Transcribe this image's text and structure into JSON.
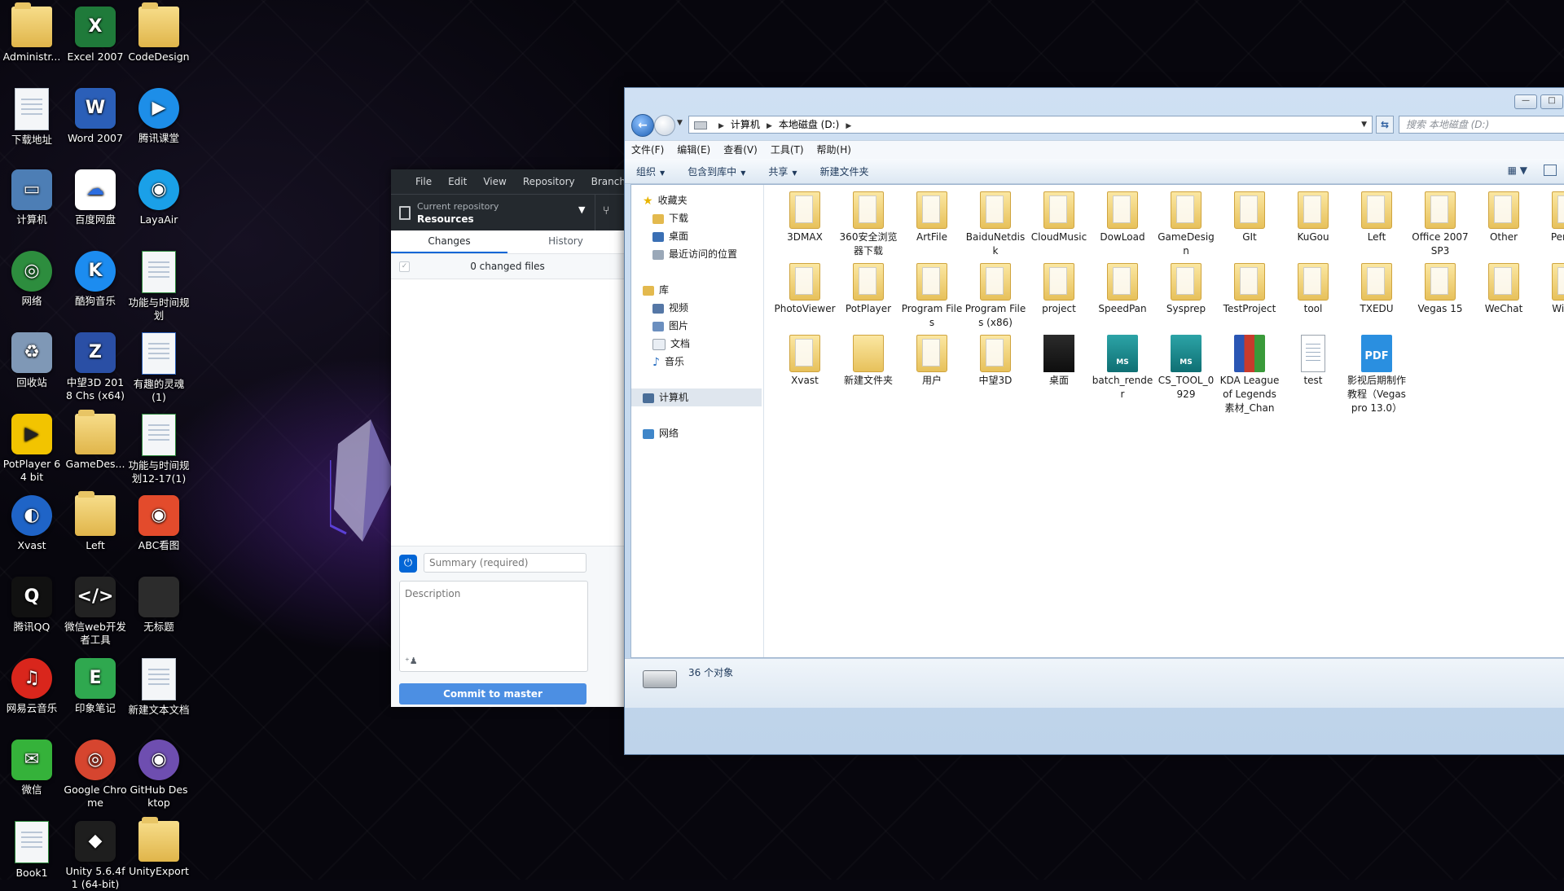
{
  "desktop": {
    "icons": [
      {
        "label": "Administr...",
        "icon": "user-folder-icon"
      },
      {
        "label": "Excel 2007",
        "icon": "excel-icon"
      },
      {
        "label": "CodeDesign",
        "icon": "folder-icon"
      },
      {
        "label": "下载地址",
        "icon": "text-file-icon"
      },
      {
        "label": "Word 2007",
        "icon": "word-icon"
      },
      {
        "label": "腾讯课堂",
        "icon": "tencent-classroom-icon"
      },
      {
        "label": "计算机",
        "icon": "computer-icon"
      },
      {
        "label": "百度网盘",
        "icon": "baidu-netdisk-icon"
      },
      {
        "label": "LayaAir",
        "icon": "layaair-icon"
      },
      {
        "label": "网络",
        "icon": "network-icon"
      },
      {
        "label": "酷狗音乐",
        "icon": "kugou-icon"
      },
      {
        "label": "功能与时间规划",
        "icon": "excel-file-icon"
      },
      {
        "label": "回收站",
        "icon": "recycle-bin-icon"
      },
      {
        "label": "中望3D 2018 Chs (x64)",
        "icon": "zw3d-icon"
      },
      {
        "label": "有趣的灵魂 (1)",
        "icon": "word-file-icon"
      },
      {
        "label": "PotPlayer 64 bit",
        "icon": "potplayer-icon"
      },
      {
        "label": "GameDes...",
        "icon": "folder-icon"
      },
      {
        "label": "功能与时间规划12-17(1)",
        "icon": "excel-file-icon"
      },
      {
        "label": "Xvast",
        "icon": "xvast-icon"
      },
      {
        "label": "Left",
        "icon": "folder-icon"
      },
      {
        "label": "ABC看图",
        "icon": "abc-viewer-icon"
      },
      {
        "label": "腾讯QQ",
        "icon": "qq-icon"
      },
      {
        "label": "微信web开发者工具",
        "icon": "wechat-devtools-icon"
      },
      {
        "label": "无标题",
        "icon": "untitled-icon"
      },
      {
        "label": "网易云音乐",
        "icon": "netease-music-icon"
      },
      {
        "label": "印象笔记",
        "icon": "evernote-icon"
      },
      {
        "label": "新建文本文档",
        "icon": "text-file-icon"
      },
      {
        "label": "微信",
        "icon": "wechat-icon"
      },
      {
        "label": "Google Chrome",
        "icon": "chrome-icon"
      },
      {
        "label": "GitHub Desktop",
        "icon": "github-icon"
      },
      {
        "label": "Book1",
        "icon": "excel-file-icon"
      },
      {
        "label": "Unity 5.6.4f1 (64-bit)",
        "icon": "unity-icon"
      },
      {
        "label": "UnityExport",
        "icon": "folder-icon"
      }
    ]
  },
  "github": {
    "menu": [
      "File",
      "Edit",
      "View",
      "Repository",
      "Branch"
    ],
    "repo_caption": "Current repository",
    "repo_name": "Resources",
    "tabs": [
      "Changes",
      "History"
    ],
    "changed_files": "0 changed files",
    "summary_placeholder": "Summary (required)",
    "description_placeholder": "Description",
    "commit_label": "Commit to master"
  },
  "explorer": {
    "window_controls": [
      "—",
      "□"
    ],
    "breadcrumb": [
      "计算机",
      "本地磁盘 (D:)"
    ],
    "search_placeholder": "搜索 本地磁盘 (D:)",
    "menu": [
      "文件(F)",
      "编辑(E)",
      "查看(V)",
      "工具(T)",
      "帮助(H)"
    ],
    "toolbar": [
      "组织",
      "包含到库中",
      "共享",
      "新建文件夹"
    ],
    "nav": {
      "favorites": "收藏夹",
      "fav_items": [
        "下载",
        "桌面",
        "最近访问的位置"
      ],
      "libraries": "库",
      "lib_items": [
        "视频",
        "图片",
        "文档",
        "音乐"
      ],
      "computer": "计算机",
      "network": "网络"
    },
    "files": [
      {
        "name": "3DMAX",
        "type": "folder"
      },
      {
        "name": "360安全浏览器下载",
        "type": "folder"
      },
      {
        "name": "ArtFile",
        "type": "folder"
      },
      {
        "name": "BaiduNetdisk",
        "type": "folder"
      },
      {
        "name": "CloudMusic",
        "type": "folder"
      },
      {
        "name": "DowLoad",
        "type": "folder"
      },
      {
        "name": "GameDesign",
        "type": "folder"
      },
      {
        "name": "GIt",
        "type": "folder"
      },
      {
        "name": "KuGou",
        "type": "folder"
      },
      {
        "name": "Left",
        "type": "folder"
      },
      {
        "name": "Office 2007 SP3",
        "type": "folder"
      },
      {
        "name": "Other",
        "type": "folder"
      },
      {
        "name": "Person",
        "type": "folder"
      },
      {
        "name": "PhotoViewer",
        "type": "folder"
      },
      {
        "name": "PotPlayer",
        "type": "folder"
      },
      {
        "name": "Program Files",
        "type": "folder"
      },
      {
        "name": "Program Files (x86)",
        "type": "folder"
      },
      {
        "name": "project",
        "type": "folder"
      },
      {
        "name": "SpeedPan",
        "type": "folder"
      },
      {
        "name": "Sysprep",
        "type": "folder"
      },
      {
        "name": "TestProject",
        "type": "folder"
      },
      {
        "name": "tool",
        "type": "folder"
      },
      {
        "name": "TXEDU",
        "type": "folder"
      },
      {
        "name": "Vegas 15",
        "type": "folder"
      },
      {
        "name": "WeChat",
        "type": "folder"
      },
      {
        "name": "Windo",
        "type": "folder"
      },
      {
        "name": "Xvast",
        "type": "folder"
      },
      {
        "name": "新建文件夹",
        "type": "folder-plain"
      },
      {
        "name": "用户",
        "type": "folder"
      },
      {
        "name": "中望3D",
        "type": "folder"
      },
      {
        "name": "桌面",
        "type": "folder-dark"
      },
      {
        "name": "batch_render",
        "type": "ms"
      },
      {
        "name": "CS_TOOL_0929",
        "type": "ms"
      },
      {
        "name": "KDA League of Legends 素材_Chan",
        "type": "rar"
      },
      {
        "name": "test",
        "type": "txt"
      },
      {
        "name": "影视后期制作教程（Vegas pro 13.0）",
        "type": "pdf"
      }
    ],
    "status": "36 个对象"
  }
}
